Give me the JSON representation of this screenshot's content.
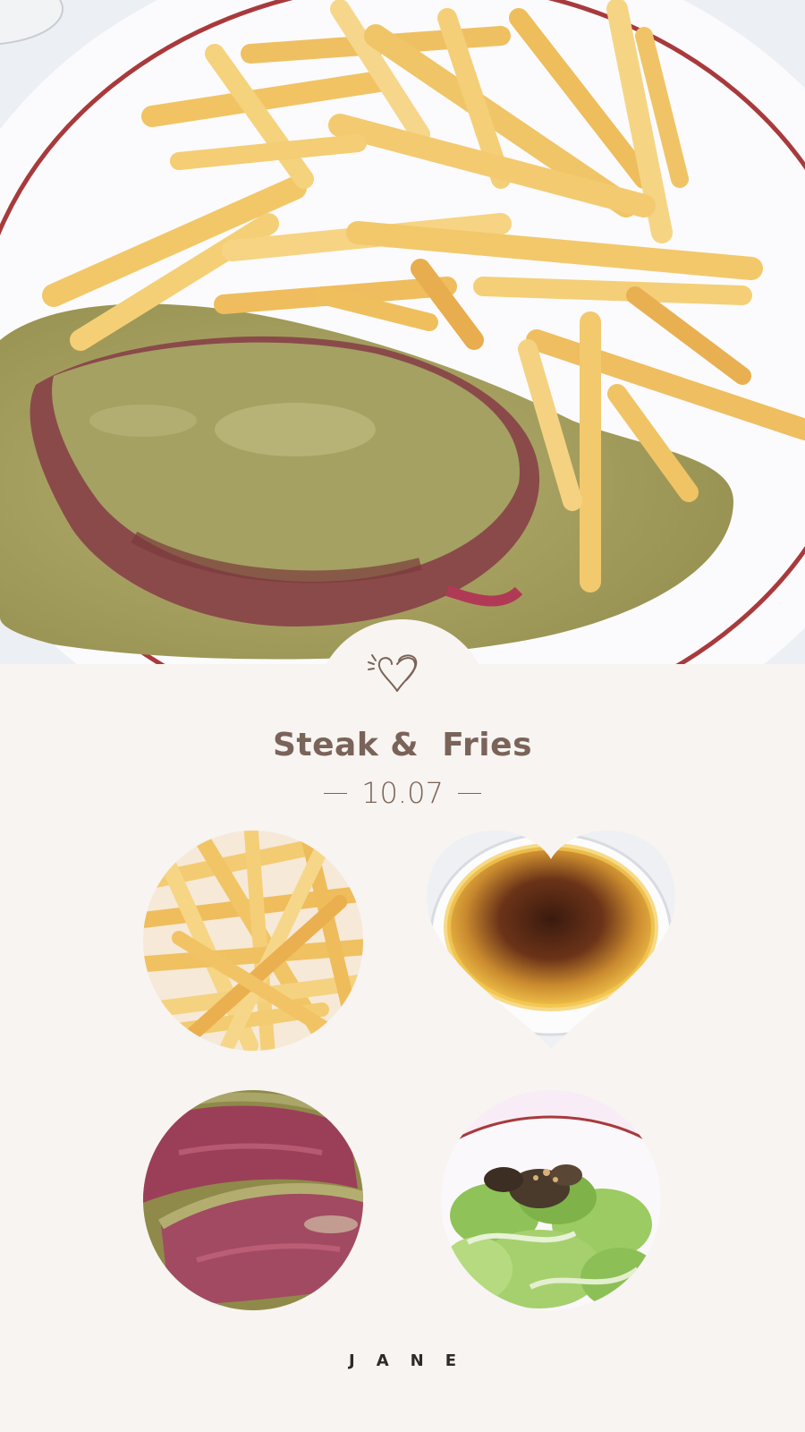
{
  "post": {
    "title": "Steak &  Fries",
    "date": "10.07",
    "signature": "JANE"
  },
  "icons": {
    "badge": "sparkling-heart-icon"
  },
  "photos": {
    "hero": "steak with green peppercorn sauce and fries on a red-rimmed plate",
    "grid": [
      "fries",
      "creme brulee",
      "sliced steak",
      "salad"
    ]
  },
  "colors": {
    "background": "#f7f4f1",
    "text_accent": "#7a6358",
    "signature": "#2e2a28",
    "plate_rim": "#a83a3c"
  }
}
